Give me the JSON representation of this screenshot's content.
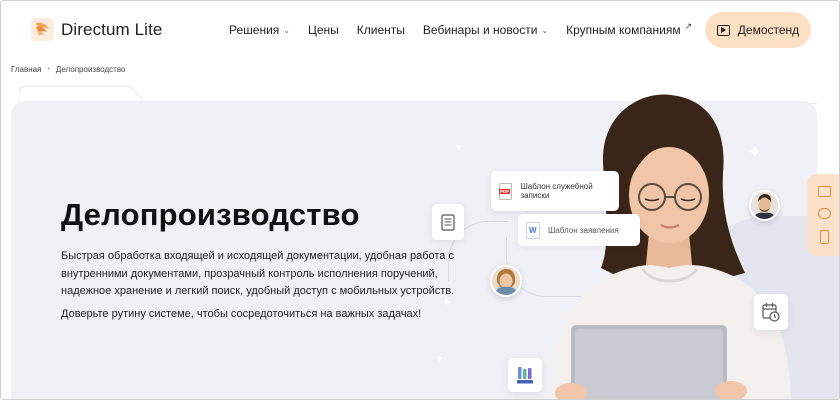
{
  "header": {
    "logo_text": "Directum Lite",
    "nav": [
      {
        "label": "Решения",
        "has_dropdown": true
      },
      {
        "label": "Цены",
        "has_dropdown": false
      },
      {
        "label": "Клиенты",
        "has_dropdown": false
      },
      {
        "label": "Вебинары и новости",
        "has_dropdown": true
      },
      {
        "label": "Крупным компаниям",
        "external": true
      }
    ],
    "demo_button": "Демостенд"
  },
  "breadcrumb": {
    "home": "Главная",
    "current": "Делопроизводство"
  },
  "hero": {
    "title": "Делопроизводство",
    "description": "Быстрая обработка входящей и исходящей документации, удобная работа с внутренними документами, прозрачный контроль исполнения поручений, надежное хранение и легкий поиск, удобный доступ с мобильных устройств.",
    "cta_text": "Доверьте рутину системе, чтобы сосредоточиться на важных задачах!",
    "cards": {
      "memo_template": "Шаблон служебной записки",
      "application_template": "Шаблон заявления"
    }
  },
  "colors": {
    "accent_peach": "#fde0c4",
    "hero_bg": "#eff1f6",
    "side_widget": "#fbe1c9",
    "icon_orange": "#e28a3e"
  },
  "icons": {
    "logo": "directum-logo-icon",
    "demo": "play-icon",
    "side": [
      "mail-icon",
      "chat-icon",
      "phone-icon"
    ]
  }
}
